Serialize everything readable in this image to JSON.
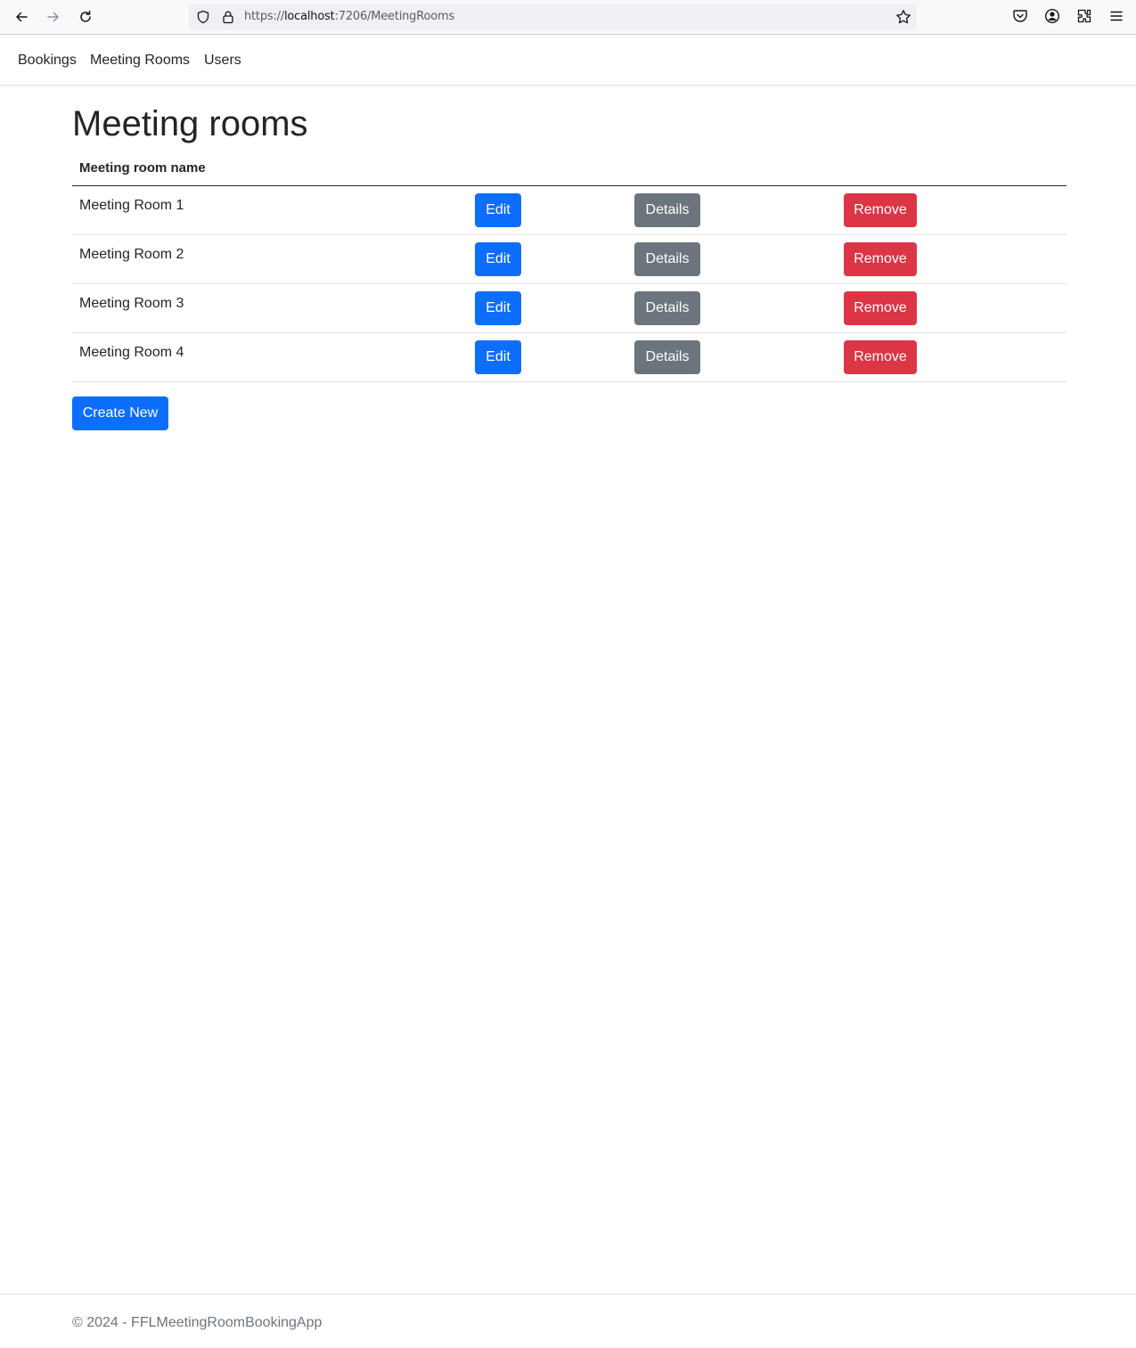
{
  "browser": {
    "url_scheme": "https://",
    "url_host": "localhost",
    "url_rest": ":7206/MeetingRooms",
    "icons": [
      "back-icon",
      "forward-icon",
      "reload-icon",
      "shield-icon",
      "lock-icon",
      "star-icon",
      "pocket-icon",
      "account-icon",
      "extensions-icon",
      "menu-icon"
    ]
  },
  "nav": {
    "items": [
      {
        "label": "Bookings"
      },
      {
        "label": "Meeting Rooms"
      },
      {
        "label": "Users"
      }
    ]
  },
  "page": {
    "title": "Meeting rooms"
  },
  "table": {
    "header": {
      "name": "Meeting room name"
    },
    "rows": [
      {
        "name": "Meeting Room 1",
        "edit": "Edit",
        "details": "Details",
        "remove": "Remove"
      },
      {
        "name": "Meeting Room 2",
        "edit": "Edit",
        "details": "Details",
        "remove": "Remove"
      },
      {
        "name": "Meeting Room 3",
        "edit": "Edit",
        "details": "Details",
        "remove": "Remove"
      },
      {
        "name": "Meeting Room 4",
        "edit": "Edit",
        "details": "Details",
        "remove": "Remove"
      }
    ]
  },
  "actions": {
    "create_new": "Create New"
  },
  "footer": {
    "text": "© 2024 - FFLMeetingRoomBookingApp"
  },
  "colors": {
    "primary": "#0d6efd",
    "secondary": "#6c757d",
    "danger": "#dc3545"
  }
}
